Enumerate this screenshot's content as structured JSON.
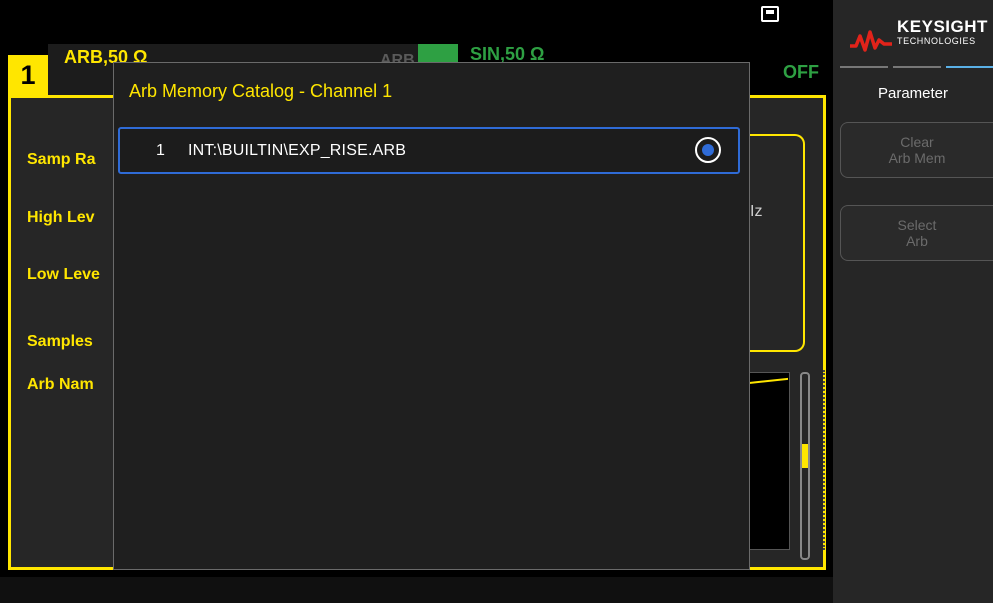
{
  "channel1": {
    "number": "1",
    "mode": "ARB,50 Ω"
  },
  "channel2": {
    "dim_text": "ARB",
    "mode": "SIN,50 Ω",
    "state": "OFF"
  },
  "parameters": {
    "samp_rate_label": "Samp Ra",
    "high_level_label": "High Lev",
    "low_level_label": "Low Leve",
    "samples_label": "Samples",
    "arb_name_label": "Arb Nam",
    "unit_partial": "Iz"
  },
  "dialog": {
    "title": "Arb Memory Catalog - Channel 1",
    "items": [
      {
        "index": "1",
        "name": "INT:\\BUILTIN\\EXP_RISE.ARB",
        "selected": true
      }
    ]
  },
  "brand": {
    "name": "KEYSIGHT",
    "sub": "TECHNOLOGIES"
  },
  "softkeys": {
    "menu_title": "Parameter",
    "clear_line1": "Clear",
    "clear_line2": "Arb Mem",
    "select_line1": "Select",
    "select_line2": "Arb"
  },
  "icons": {
    "status": "lan-icon",
    "selection": "radio-selected-icon",
    "logo": "keysight-wave-icon"
  },
  "colors": {
    "channel1": "#ffe600",
    "channel2": "#2ea043",
    "accent": "#2f6bd6",
    "tab_active": "#5ab0e6"
  }
}
